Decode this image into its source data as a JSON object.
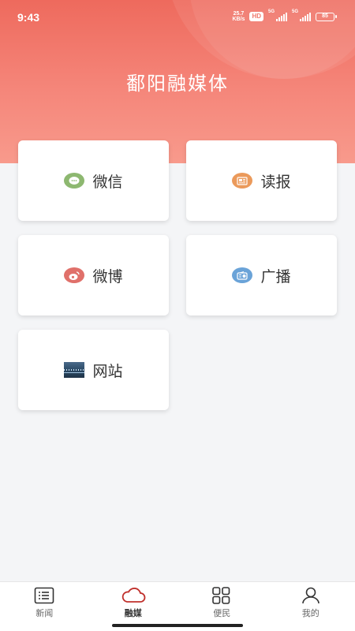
{
  "status": {
    "time": "9:43",
    "net_speed_value": "25.7",
    "net_speed_unit": "KB/s",
    "hd": "HD",
    "signal1": "5G",
    "signal2": "5G",
    "battery": "85"
  },
  "header": {
    "title": "鄱阳融媒体",
    "accent_color": "#ee6a5d"
  },
  "cards": [
    {
      "label": "微信",
      "icon": "wechat-icon",
      "color": "#8db870"
    },
    {
      "label": "读报",
      "icon": "newspaper-icon",
      "color": "#eb9a5b"
    },
    {
      "label": "微博",
      "icon": "weibo-icon",
      "color": "#e0706a"
    },
    {
      "label": "广播",
      "icon": "radio-icon",
      "color": "#6aa3d8"
    },
    {
      "label": "网站",
      "icon": "website-thumbnail-icon",
      "color": "#2b4a66"
    }
  ],
  "bottom_nav": [
    {
      "label": "新闻",
      "icon": "list-icon",
      "active": false
    },
    {
      "label": "融媒",
      "icon": "cloud-icon",
      "active": true
    },
    {
      "label": "便民",
      "icon": "grid-icon",
      "active": false
    },
    {
      "label": "我的",
      "icon": "user-icon",
      "active": false
    }
  ]
}
